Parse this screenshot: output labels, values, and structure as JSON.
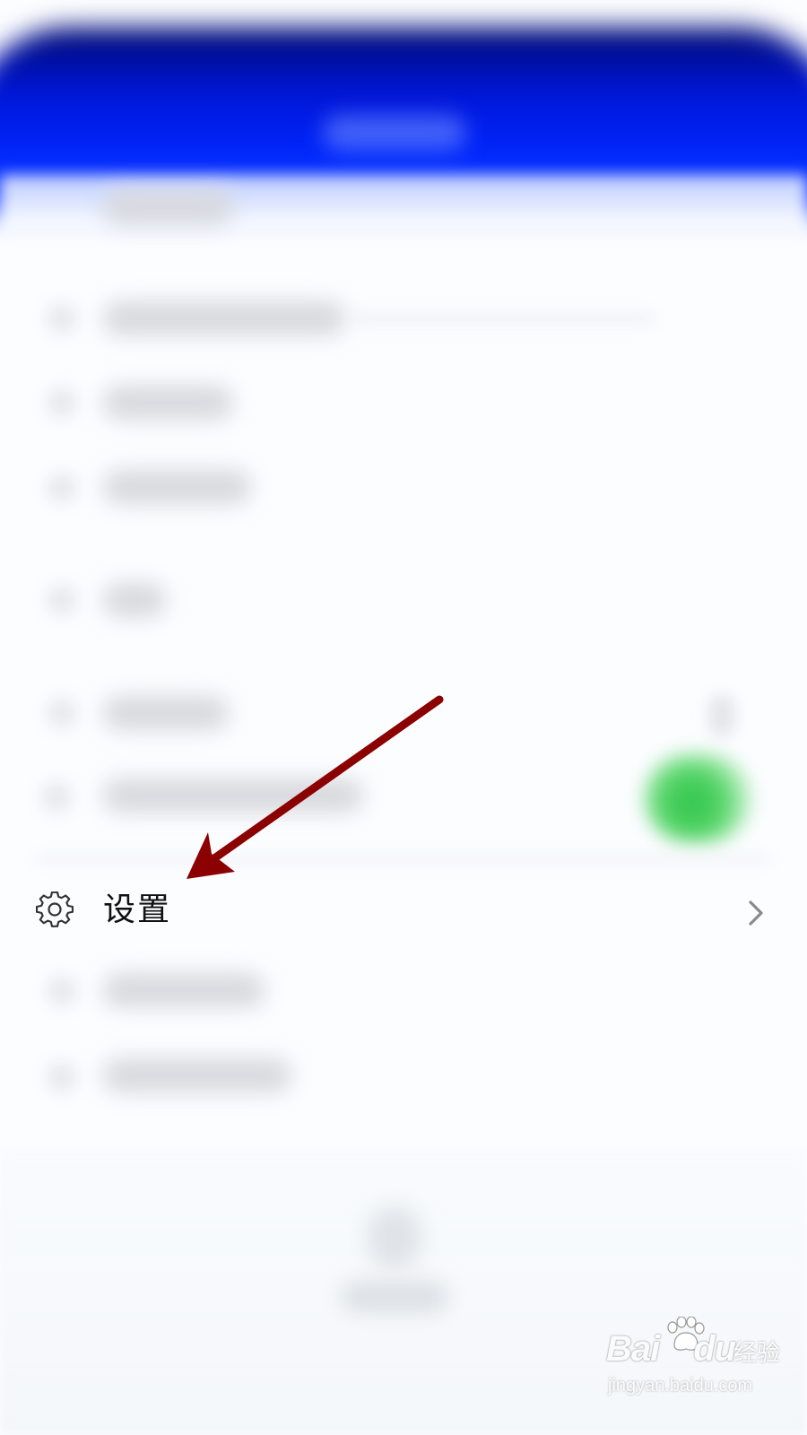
{
  "settings_row": {
    "label": "设置",
    "icon": "gear-icon",
    "chevron_icon": "chevron-right-icon"
  },
  "annotation": {
    "arrow_color": "#8b0000"
  },
  "header": {
    "color": "#0022ff"
  },
  "toggle": {
    "state": "on",
    "color": "#3ec956"
  },
  "watermark": {
    "logo_prefix": "Bai",
    "logo_suffix": "du",
    "product": "经验",
    "url": "jingyan.baidu.com"
  }
}
